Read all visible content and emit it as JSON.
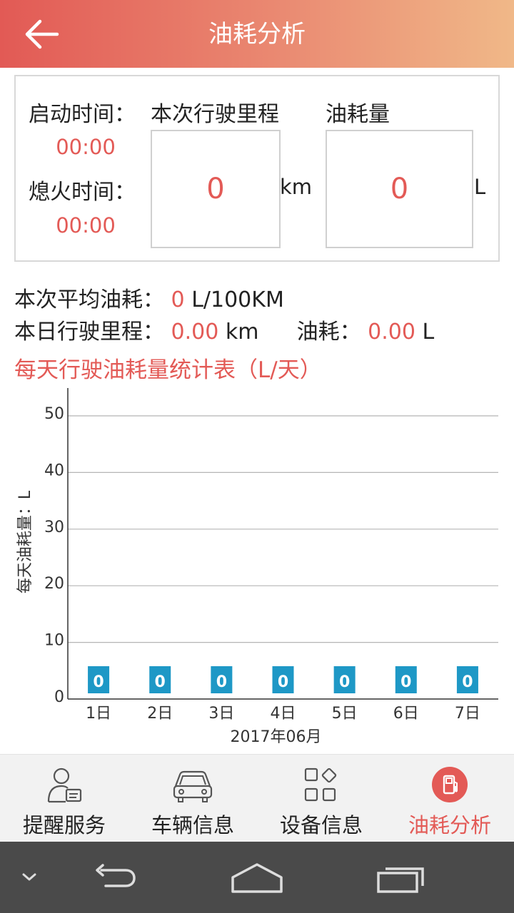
{
  "header": {
    "title": "油耗分析",
    "back_icon": "arrow-left-icon"
  },
  "trip": {
    "start_label": "启动时间：",
    "start_time": "00:00",
    "stop_label": "熄火时间：",
    "stop_time": "00:00",
    "mileage_label": "本次行驶里程",
    "mileage_value": "0",
    "mileage_unit": "km",
    "fuel_label": "油耗量",
    "fuel_value": "0",
    "fuel_unit": "L"
  },
  "stats": {
    "avg_label": "本次平均油耗：",
    "avg_value": "0",
    "avg_unit": "L/100KM",
    "day_mileage_label": "本日行驶里程：",
    "day_mileage_value": "0.00",
    "day_mileage_unit": "km",
    "day_fuel_label": "油耗：",
    "day_fuel_value": "0.00",
    "day_fuel_unit": "L"
  },
  "chart_title": "每天行驶油耗量统计表（L/天）",
  "chart_data": {
    "type": "bar",
    "categories": [
      "1日",
      "2日",
      "3日",
      "4日",
      "5日",
      "6日",
      "7日"
    ],
    "values": [
      0,
      0,
      0,
      0,
      0,
      0,
      0
    ],
    "data_labels": [
      "0",
      "0",
      "0",
      "0",
      "0",
      "0",
      "0"
    ],
    "xlabel": "2017年06月",
    "ylabel": "每天油耗量：L",
    "ylim": [
      0,
      50
    ],
    "yticks": [
      0,
      10,
      20,
      30,
      40,
      50
    ],
    "grid": true,
    "bar_color": "#1e98c6"
  },
  "nav": {
    "items": [
      {
        "label": "提醒服务",
        "icon": "person-card-icon",
        "active": false
      },
      {
        "label": "车辆信息",
        "icon": "car-icon",
        "active": false
      },
      {
        "label": "设备信息",
        "icon": "device-grid-icon",
        "active": false
      },
      {
        "label": "油耗分析",
        "icon": "fuel-pump-icon",
        "active": true
      }
    ]
  },
  "colors": {
    "accent": "#e35a56",
    "header_start": "#e25a55",
    "header_end": "#f0b888",
    "bar": "#1e98c6"
  }
}
